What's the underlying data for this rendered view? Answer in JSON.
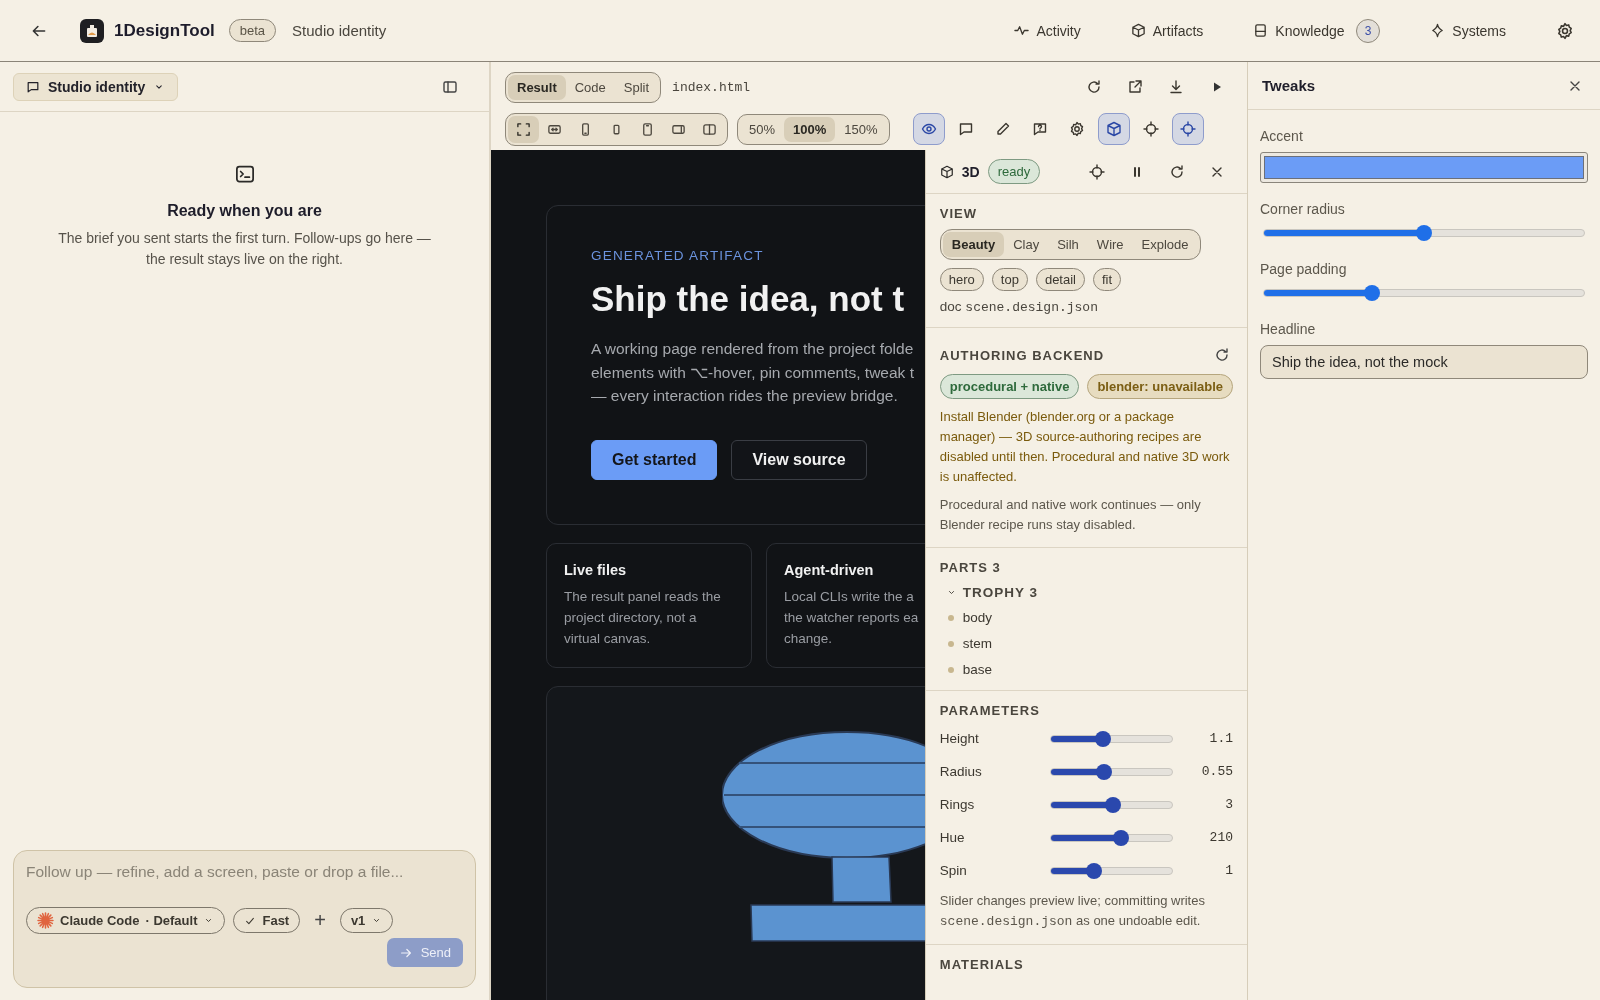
{
  "topbar": {
    "app_name": "1DesignTool",
    "badge": "beta",
    "project": "Studio identity",
    "nav": [
      {
        "label": "Activity",
        "kind": "pulse"
      },
      {
        "label": "Artifacts",
        "kind": "cube"
      },
      {
        "label": "Knowledge",
        "kind": "book",
        "count": "3"
      },
      {
        "label": "Systems",
        "kind": "sparkle"
      }
    ]
  },
  "sidebar": {
    "conversation": "Studio identity",
    "empty_title": "Ready when you are",
    "empty_text": "The brief you sent starts the first turn. Follow-ups go here — the result stays live on the right.",
    "composer": {
      "placeholder": "Follow up — refine, add a screen, paste or drop a file...",
      "agent": "Claude Code",
      "mode": "· Default",
      "speed": "Fast",
      "add": "+",
      "version": "v1",
      "send": "Send",
      "send_disabled": true
    }
  },
  "preview": {
    "view_tabs": [
      {
        "label": "Result",
        "selected": true
      },
      {
        "label": "Code",
        "selected": false
      },
      {
        "label": "Split",
        "selected": false
      }
    ],
    "file": "index.html",
    "devices": [
      {
        "kind": "fit",
        "selected": true
      },
      {
        "kind": "width",
        "selected": false
      },
      {
        "kind": "phone",
        "selected": false
      },
      {
        "kind": "small-phone",
        "selected": false
      },
      {
        "kind": "tablet",
        "selected": false
      },
      {
        "kind": "landscape",
        "selected": false
      },
      {
        "kind": "split",
        "selected": false
      }
    ],
    "zoom": [
      {
        "label": "50%",
        "selected": false
      },
      {
        "label": "100%",
        "selected": true
      },
      {
        "label": "150%",
        "selected": false
      }
    ],
    "tools": [
      {
        "kind": "eye",
        "selected": true
      },
      {
        "kind": "comment",
        "selected": false
      },
      {
        "kind": "pencil",
        "selected": false
      },
      {
        "kind": "help",
        "selected": false
      },
      {
        "kind": "gear",
        "selected": false
      },
      {
        "kind": "cube",
        "selected": true
      },
      {
        "kind": "crosshair",
        "selected": false
      },
      {
        "kind": "crosshair",
        "selected": true
      }
    ],
    "artifact": {
      "eyebrow": "GENERATED ARTIFACT",
      "headline": "Ship the idea, not t",
      "body_lines": [
        "A working page rendered from the project folde",
        "elements with ⌥-hover, pin comments, tweak t",
        "— every interaction rides the preview bridge."
      ],
      "buttons": [
        {
          "label": "Get started",
          "kind": "primary"
        },
        {
          "label": "View source",
          "kind": "secondary"
        }
      ],
      "cards": [
        {
          "title": "Live files",
          "lines": [
            "The result panel reads the",
            "project directory, not a",
            "virtual canvas."
          ]
        },
        {
          "title": "Agent-driven",
          "lines": [
            "Local CLIs write the a",
            "the watcher reports ea",
            "change."
          ]
        }
      ]
    }
  },
  "scene": {
    "title": "3D",
    "status": "ready",
    "view_label": "VIEW",
    "modes": [
      {
        "label": "Beauty",
        "selected": true
      },
      {
        "label": "Clay",
        "selected": false
      },
      {
        "label": "Silh",
        "selected": false
      },
      {
        "label": "Wire",
        "selected": false
      },
      {
        "label": "Explode",
        "selected": false
      }
    ],
    "cameras": [
      "hero",
      "top",
      "detail",
      "fit"
    ],
    "doc_label": "doc",
    "doc_file": "scene.design.json",
    "backend_title": "AUTHORING BACKEND",
    "backends": [
      {
        "label": "procedural + native",
        "kind": "ok"
      },
      {
        "label": "blender: unavailable",
        "kind": "warn"
      }
    ],
    "warning": "Install Blender (blender.org or a package manager) — 3D source-authoring recipes are disabled until then. Procedural and native 3D work is unaffected.",
    "note": "Procedural and native work continues — only Blender recipe runs stay disabled.",
    "parts_title": "PARTS",
    "parts_count": "3",
    "parts": [
      {
        "label": "TROPHY",
        "count": "3",
        "expanded": true,
        "children": [
          {
            "label": "body"
          },
          {
            "label": "stem"
          },
          {
            "label": "base"
          }
        ]
      }
    ],
    "params_title": "PARAMETERS",
    "params": [
      {
        "label": "Height",
        "level": 0.43,
        "reading": "1.1"
      },
      {
        "label": "Radius",
        "level": 0.44,
        "reading": "0.55"
      },
      {
        "label": "Rings",
        "level": 0.51,
        "reading": "3"
      },
      {
        "label": "Hue",
        "level": 0.58,
        "reading": "210"
      },
      {
        "label": "Spin",
        "level": 0.36,
        "reading": "1"
      }
    ],
    "params_note": {
      "before": "Slider changes preview live; committing writes",
      "file": "scene.design.json",
      "after": "as one undoable edit."
    },
    "materials_title": "MATERIALS"
  },
  "tweaks": {
    "title": "Tweaks",
    "fields": [
      {
        "kind": "color",
        "label": "Accent",
        "color": "#6b9cf6"
      },
      {
        "kind": "slider",
        "label": "Corner radius",
        "level": 0.5
      },
      {
        "kind": "slider",
        "label": "Page padding",
        "level": 0.34
      },
      {
        "kind": "text",
        "label": "Headline",
        "value": "Ship the idea, not the mock"
      }
    ]
  }
}
